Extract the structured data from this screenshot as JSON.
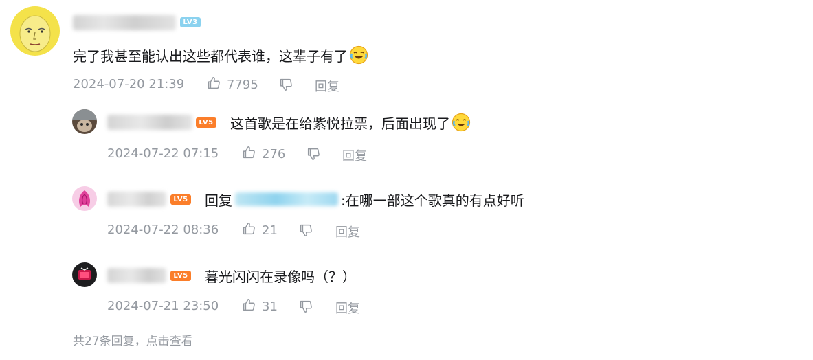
{
  "comment": {
    "level_badge": "LV3",
    "text": "完了我甚至能认出这些都代表谁，这辈子有了",
    "timestamp": "2024-07-20 21:39",
    "like_count": "7795",
    "reply_label": "回复",
    "colors": {
      "badge": "#8bd2ef"
    }
  },
  "replies": [
    {
      "level_badge": "LV5",
      "text": "这首歌是在给紫悦拉票，后面出现了",
      "timestamp": "2024-07-22 07:15",
      "like_count": "276",
      "reply_label": "回复"
    },
    {
      "level_badge": "LV5",
      "reply_prefix": "回复",
      "reply_suffix": ":在哪一部这个歌真的有点好听",
      "timestamp": "2024-07-22 08:36",
      "like_count": "21",
      "reply_label": "回复"
    },
    {
      "level_badge": "LV5",
      "text": "暮光闪闪在录像吗（？）",
      "timestamp": "2024-07-21 23:50",
      "like_count": "31",
      "reply_label": "回复"
    }
  ],
  "footer": {
    "more_replies": "共27条回复，点击查看"
  },
  "colors": {
    "lv5_badge": "#fb7e2a",
    "meta_text": "#9499a0",
    "main_text": "#18191c"
  },
  "icons": [
    "like-icon",
    "dislike-icon",
    "cry-laugh-emoji"
  ]
}
